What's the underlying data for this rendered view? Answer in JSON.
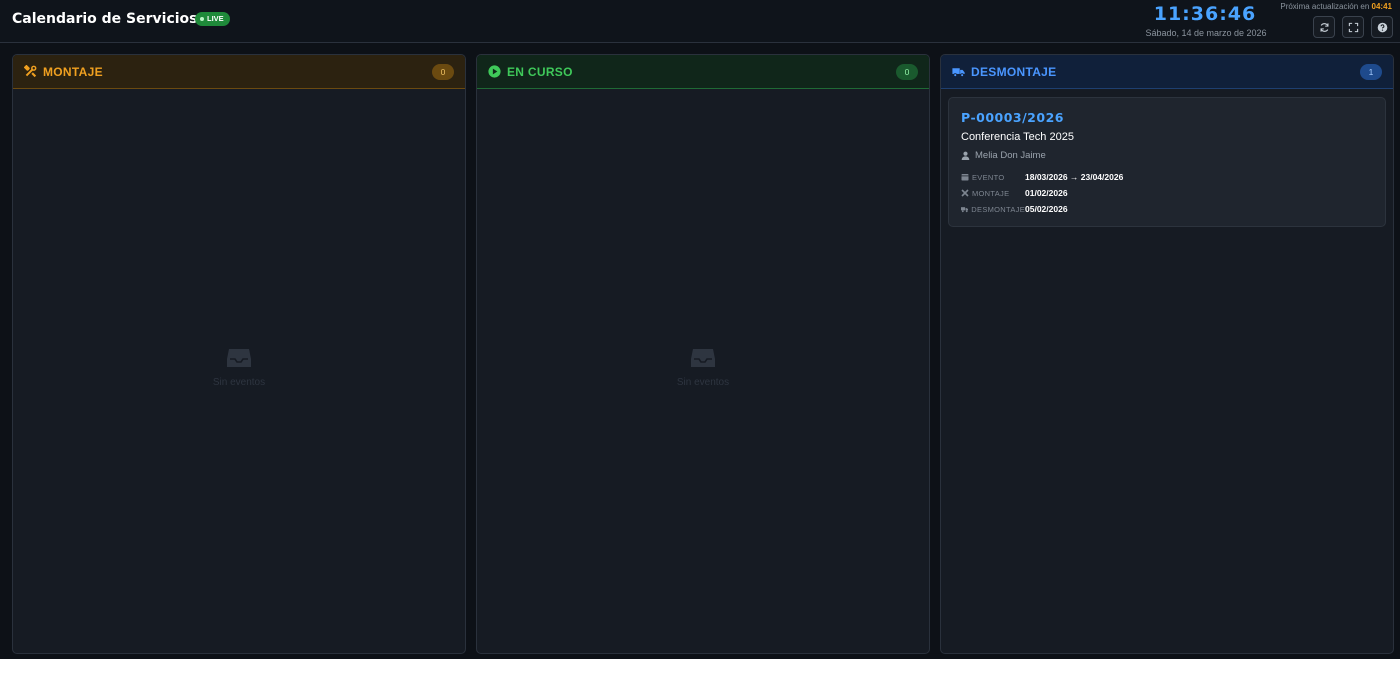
{
  "header": {
    "title": "Calendario de Servicios",
    "live_label": "LIVE",
    "clock": "11:36:46",
    "date": "Sábado, 14 de marzo de 2026",
    "next_update_label": "Próxima actualización en",
    "next_update_countdown": "04:41",
    "buttons": [
      "refresh-icon",
      "fullscreen-icon",
      "help-icon"
    ]
  },
  "columns": [
    {
      "title": "MONTAJE",
      "count": "0",
      "icon": "tools-icon",
      "empty_text": "Sin eventos",
      "accent": "#f0a020"
    },
    {
      "title": "EN CURSO",
      "count": "0",
      "icon": "play-icon",
      "empty_text": "Sin eventos",
      "accent": "#3fc95a"
    },
    {
      "title": "DESMONTAJE",
      "count": "1",
      "icon": "truck-icon",
      "accent": "#4a96ff"
    }
  ],
  "card": {
    "code": "P-00003/2026",
    "name": "Conferencia Tech 2025",
    "venue": "Melia Don Jaime",
    "rows": [
      {
        "label": "EVENTO",
        "value": "18/03/2026 → 23/04/2026",
        "icon": "calendar-icon"
      },
      {
        "label": "MONTAJE",
        "value": "01/02/2026",
        "icon": "tools-icon"
      },
      {
        "label": "DESMONTAJE",
        "value": "05/02/2026",
        "icon": "truck-icon"
      }
    ]
  }
}
